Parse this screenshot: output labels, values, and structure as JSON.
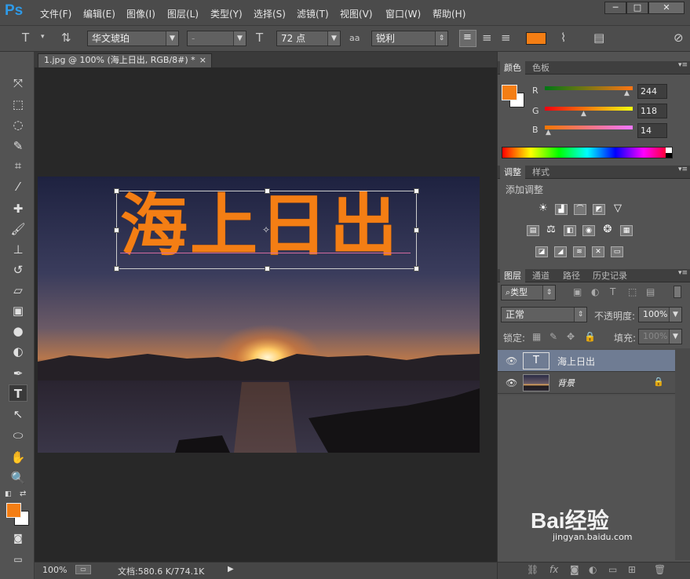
{
  "app": {
    "logo": "Ps"
  },
  "menu": [
    "文件(F)",
    "编辑(E)",
    "图像(I)",
    "图层(L)",
    "类型(Y)",
    "选择(S)",
    "滤镜(T)",
    "视图(V)",
    "窗口(W)",
    "帮助(H)"
  ],
  "window_buttons": [
    "─",
    "□",
    "✕"
  ],
  "options": {
    "font_family": "华文琥珀",
    "font_style": "-",
    "font_size": "72 点",
    "aa_label": "aa",
    "antialias": "锐利",
    "text_color": "#f47e14"
  },
  "document": {
    "tab_title": "1.jpg @ 100% (海上日出, RGB/8#) *",
    "tab_close": "×",
    "text_content": "海上日出",
    "text_color": "#f47e14"
  },
  "status": {
    "zoom": "100%",
    "doc_info": "文档:580.6 K/774.1K"
  },
  "color_panel": {
    "tabs": [
      "颜色",
      "色板"
    ],
    "r_label": "R",
    "g_label": "G",
    "b_label": "B",
    "r": "244",
    "g": "118",
    "b": "14",
    "foreground": "#f47e14",
    "background": "#ffffff"
  },
  "adjust_panel": {
    "tabs": [
      "调整",
      "样式"
    ],
    "title": "添加调整"
  },
  "layers_panel": {
    "tabs": [
      "图层",
      "通道",
      "路径",
      "历史记录"
    ],
    "filter": "类型",
    "blend": "正常",
    "opacity_label": "不透明度:",
    "opacity": "100%",
    "lock_label": "锁定:",
    "fill_label": "填充:",
    "fill": "100%",
    "layers": [
      {
        "name": "海上日出",
        "type": "text",
        "selected": true
      },
      {
        "name": "背景",
        "type": "image",
        "selected": false
      }
    ]
  },
  "footer": {
    "watermark": "Bai经验",
    "watermark_url": "jingyan.baidu.com"
  }
}
